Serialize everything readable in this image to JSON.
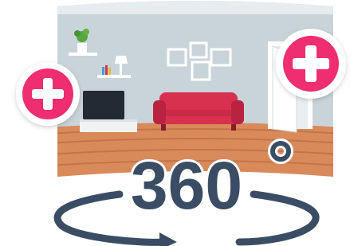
{
  "illustration": {
    "label": "360",
    "degree_symbol": "°"
  },
  "colors": {
    "wall": "#c9d4da",
    "wall_shadow": "#b8c5cc",
    "floor": "#d98a5a",
    "floor_dark": "#c4744a",
    "sofa": "#d8314f",
    "sofa_dark": "#b8243f",
    "text": "#3a4d64",
    "plus_button": "#ee2f6f",
    "plus_button_ring": "#ffffff",
    "tv": "#222a33",
    "cabinet": "#f2f2f2",
    "door": "#ffffff",
    "plant": "#55a63d"
  },
  "icons": {
    "left_button": "plus-icon",
    "right_button": "plus-icon",
    "rotation": "rotate-arrow-icon"
  }
}
